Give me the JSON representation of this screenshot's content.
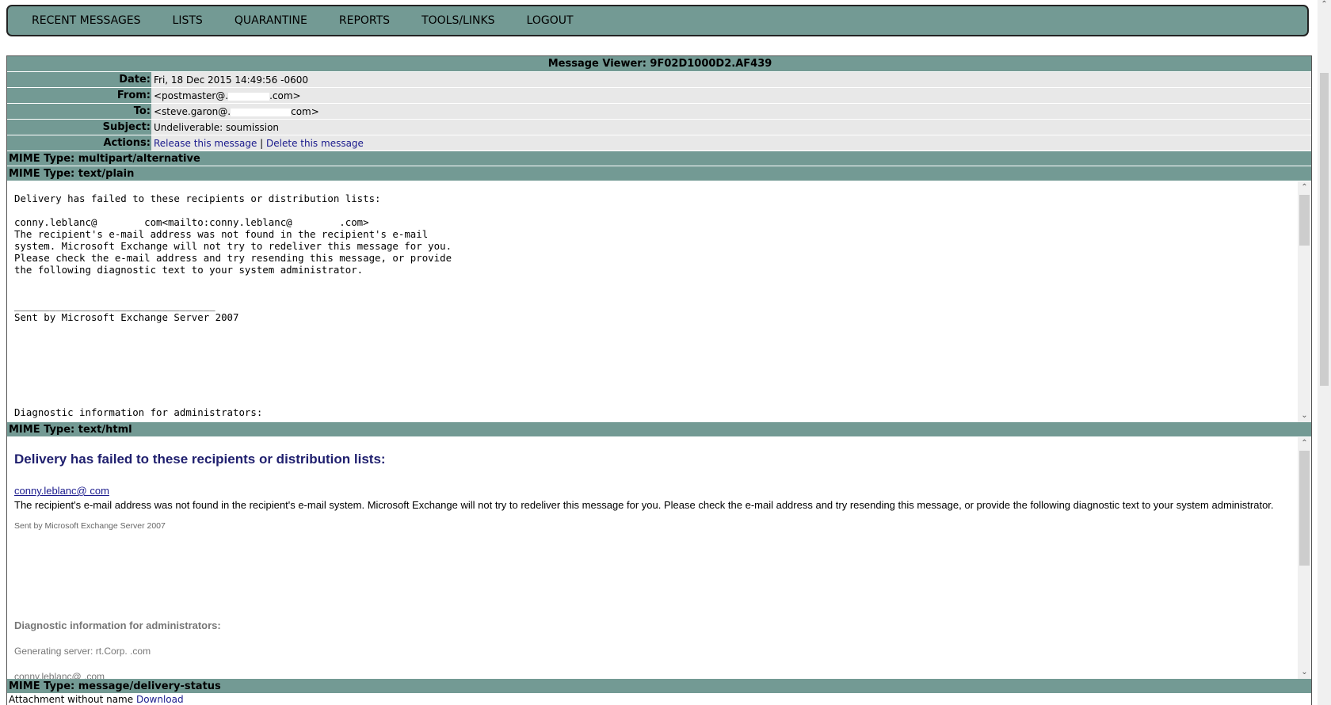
{
  "nav": {
    "items": [
      "RECENT MESSAGES",
      "LISTS",
      "QUARANTINE",
      "REPORTS",
      "TOOLS/LINKS",
      "LOGOUT"
    ]
  },
  "viewer": {
    "title": "Message Viewer: 9F02D1000D2.AF439",
    "date_label": "Date:",
    "date": "Fri, 18 Dec 2015 14:49:56 -0600",
    "from_label": "From:",
    "from_prefix": "<postmaster@.",
    "from_suffix": ".com>",
    "to_label": "To:",
    "to_prefix": "<steve.garon@.",
    "to_suffix": "com>",
    "subject_label": "Subject:",
    "subject": "Undeliverable: soumission",
    "actions_label": "Actions:",
    "release_link": "Release this message",
    "separator": "|",
    "delete_link": "Delete this message"
  },
  "mime": {
    "multipart": "MIME Type: multipart/alternative",
    "plain": "MIME Type: text/plain",
    "html": "MIME Type: text/html",
    "delivery_status": "MIME Type: message/delivery-status"
  },
  "plain_text": "Delivery has failed to these recipients or distribution lists:\n\nconny.leblanc@        com<mailto:conny.leblanc@        .com>\nThe recipient's e-mail address was not found in the recipient's e-mail\nsystem. Microsoft Exchange will not try to redeliver this message for you.\nPlease check the e-mail address and try resending this message, or provide\nthe following diagnostic text to your system administrator.\n\n\n__________________________________\nSent by Microsoft Exchange Server 2007\n\n\n\n\n\n\n\nDiagnostic information for administrators:\n\nGenerating server: rt.Corp.           .com",
  "html_part": {
    "heading": "Delivery has failed to these recipients or distribution lists:",
    "recipient": "conny.leblanc@           com",
    "paragraph": "The recipient's e-mail address was not found in the recipient's e-mail system. Microsoft Exchange will not try to redeliver this message for you. Please check the e-mail address and try resending this message, or provide the following diagnostic text to your system administrator.",
    "sent_by": "Sent by Microsoft Exchange Server 2007",
    "diag_heading": "Diagnostic information for administrators:",
    "gen_server": "Generating server: rt.Corp.             .com",
    "recipient_line": "conny.leblanc@           .com"
  },
  "attachment": {
    "text": "Attachment without name",
    "link": "Download"
  }
}
